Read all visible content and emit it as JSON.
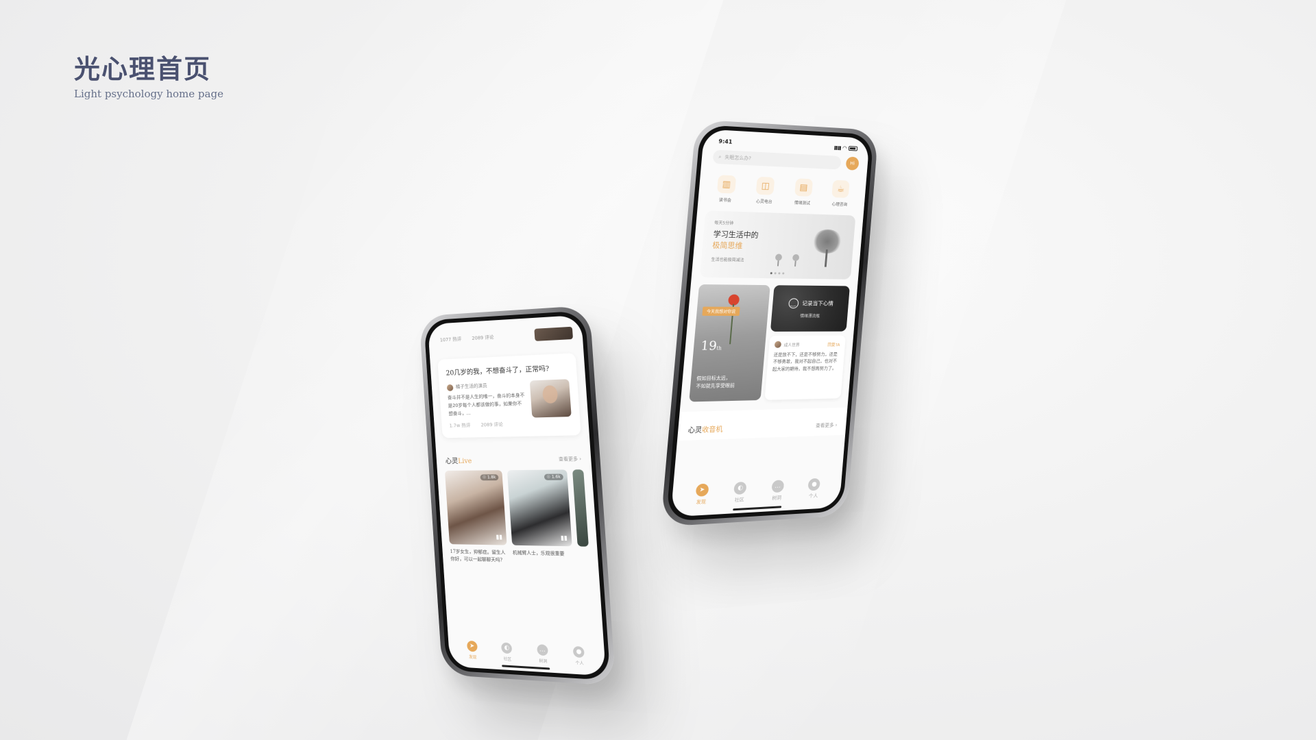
{
  "page": {
    "title": "光心理首页",
    "subtitle": "Light psychology home page"
  },
  "phone_left": {
    "top_stats": [
      "1077 热评",
      "2089 评论"
    ],
    "article": {
      "title": "20几岁的我，不想奋斗了，正常吗?",
      "author": "橘子生活的演员",
      "excerpt": "奋斗并不是人生的唯一，奋斗的本身不是20岁每个人都该做的事，如果你不想奋斗，...",
      "likes": "1.7w 热评",
      "comments": "2089 评论"
    },
    "live_section": {
      "title_prefix": "心灵",
      "title_accent": "Live",
      "more": "查看更多 ›",
      "items": [
        {
          "badge": "☉ 1.8k",
          "caption": "17岁女生，抑郁症。留生人你好，可以一起聊聊天吗?"
        },
        {
          "badge": "☉ 1.6k",
          "caption": "机械臂人士，乐观很重要"
        }
      ]
    },
    "tabs": [
      {
        "label": "发现",
        "icon": "compass-icon",
        "active": true
      },
      {
        "label": "社区",
        "icon": "planet-icon",
        "active": false
      },
      {
        "label": "树洞",
        "icon": "chat-bubble-icon",
        "active": false
      },
      {
        "label": "个人",
        "icon": "person-icon",
        "active": false
      }
    ]
  },
  "phone_right": {
    "status_time": "9:41",
    "search_placeholder": "失眠怎么办?",
    "avatar_label": "Hi",
    "quick_actions": [
      {
        "label": "读书会",
        "icon": "book-icon"
      },
      {
        "label": "心灵电台",
        "icon": "radio-icon"
      },
      {
        "label": "情绪测试",
        "icon": "notebook-icon"
      },
      {
        "label": "心理咨询",
        "icon": "coffee-cup-icon"
      }
    ],
    "banner": {
      "kicker": "每天5分钟",
      "title": "学习生活中的",
      "title_accent": "极简思维",
      "sub": "生活也能极简减法"
    },
    "today_card": {
      "tag": "今天我想对你说",
      "day": "19",
      "day_unit": "th",
      "quote_line1": "假如目标太远，",
      "quote_line2": "不如就先享受眼前"
    },
    "mood_card": {
      "title": "记录当下心情",
      "sub": "情绪漂流瓶"
    },
    "tree_hole": {
      "author": "成人世界",
      "reply": "回复TA",
      "text": "还是放不下，还是不够努力，还是不够勇敢，我对不起自己，也对不起大家的期待，我不想再努力了。"
    },
    "radio_section": {
      "title_prefix": "心灵",
      "title_accent": "收音机",
      "more": "查看更多 ›"
    },
    "tabs": [
      {
        "label": "发现",
        "icon": "compass-icon",
        "active": true
      },
      {
        "label": "社区",
        "icon": "planet-icon",
        "active": false
      },
      {
        "label": "树洞",
        "icon": "chat-bubble-icon",
        "active": false
      },
      {
        "label": "个人",
        "icon": "person-icon",
        "active": false
      }
    ]
  },
  "colors": {
    "accent": "#e6a85a",
    "title": "#4a5170",
    "background": "#f0f0f0"
  }
}
